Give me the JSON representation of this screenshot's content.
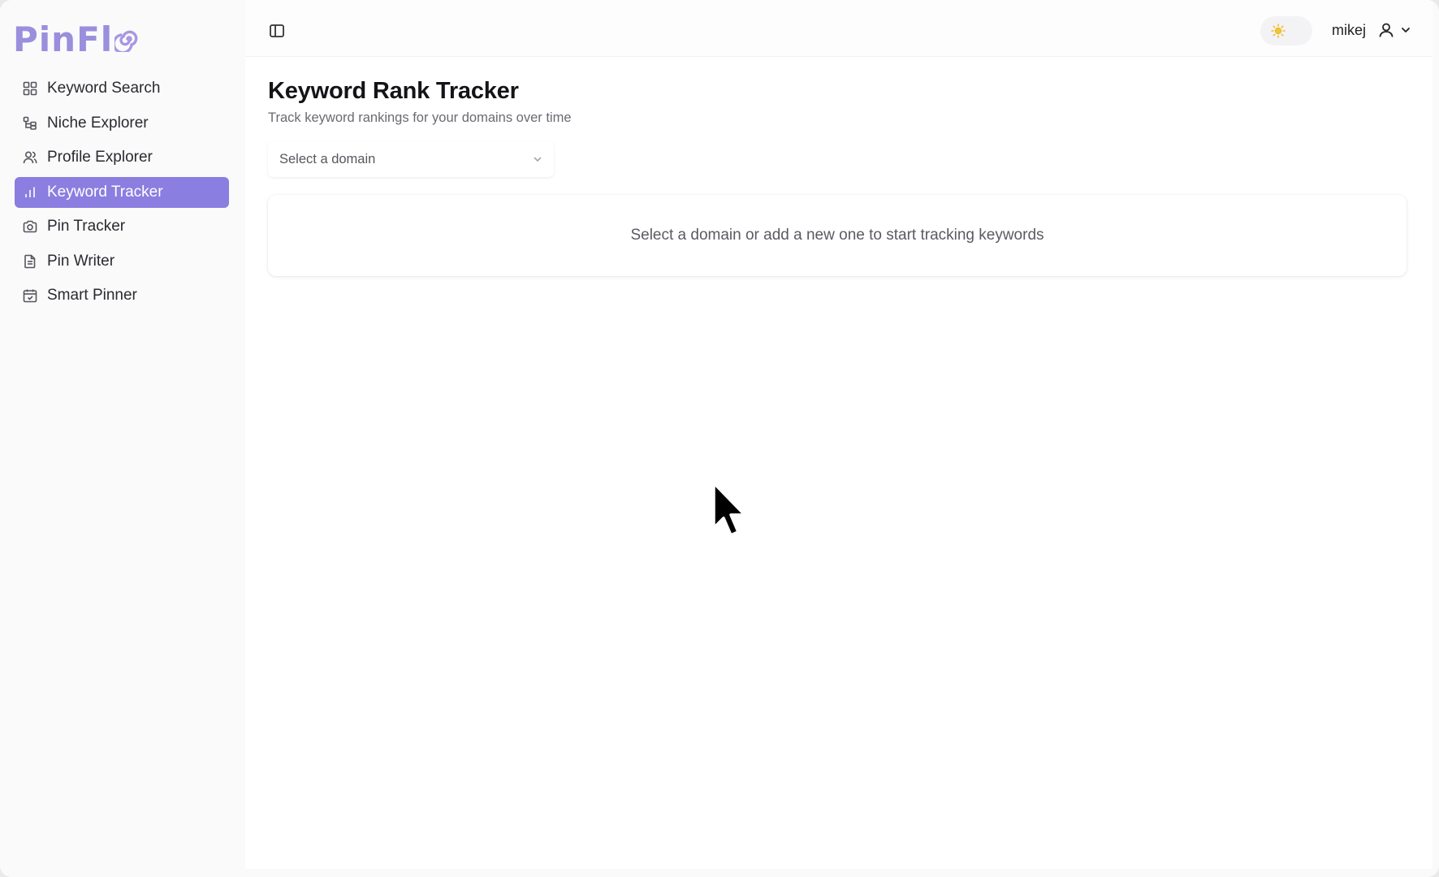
{
  "app": {
    "logo_text": "PinFl",
    "brand_color": "#8a7ee0"
  },
  "sidebar": {
    "items": [
      {
        "label": "Keyword Search",
        "icon": "grid-icon",
        "active": false
      },
      {
        "label": "Niche Explorer",
        "icon": "tree-icon",
        "active": false
      },
      {
        "label": "Profile Explorer",
        "icon": "users-icon",
        "active": false
      },
      {
        "label": "Keyword Tracker",
        "icon": "bar-chart-icon",
        "active": true
      },
      {
        "label": "Pin Tracker",
        "icon": "camera-icon",
        "active": false
      },
      {
        "label": "Pin Writer",
        "icon": "document-icon",
        "active": false
      },
      {
        "label": "Smart Pinner",
        "icon": "calendar-icon",
        "active": false
      }
    ]
  },
  "topbar": {
    "username": "mikej"
  },
  "main": {
    "title": "Keyword Rank Tracker",
    "subtitle": "Track keyword rankings for your domains over time",
    "domain_select": {
      "placeholder": "Select a domain"
    },
    "empty_state": "Select a domain or add a new one to start tracking keywords"
  }
}
